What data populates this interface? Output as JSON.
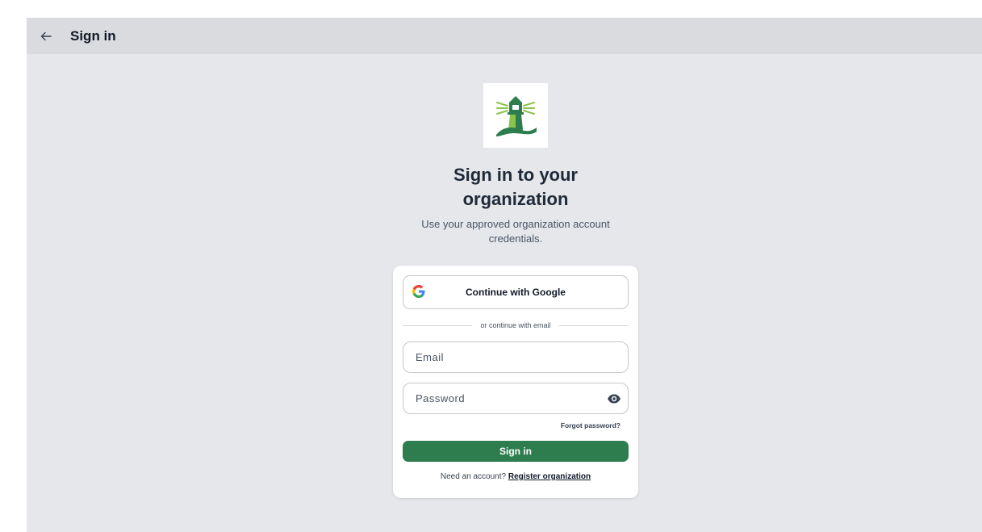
{
  "appbar": {
    "back_icon": "arrow-left-icon",
    "title": "Sign in"
  },
  "logo": {
    "icon": "lighthouse-logo",
    "colors": {
      "primary": "#2e7d4f",
      "accent": "#8bc34a"
    }
  },
  "heading": {
    "line1": "Sign in to your",
    "line2": "organization",
    "subtitle_line1": "Use your approved organization account",
    "subtitle_line2": "credentials."
  },
  "card": {
    "google_button": {
      "label": "Continue with Google",
      "icon": "google-icon"
    },
    "divider_text": "or continue with email",
    "email": {
      "placeholder": "Email",
      "value": ""
    },
    "password": {
      "placeholder": "Password",
      "value": "",
      "toggle_icon": "eye-icon"
    },
    "forgot_password": "Forgot password?",
    "signin_button": "Sign in",
    "register_prompt": "Need an account?",
    "register_link": "Register organization"
  },
  "colors": {
    "primary": "#2e7d4f",
    "background": "#e5e7eb",
    "appbar": "#d9dbde"
  }
}
